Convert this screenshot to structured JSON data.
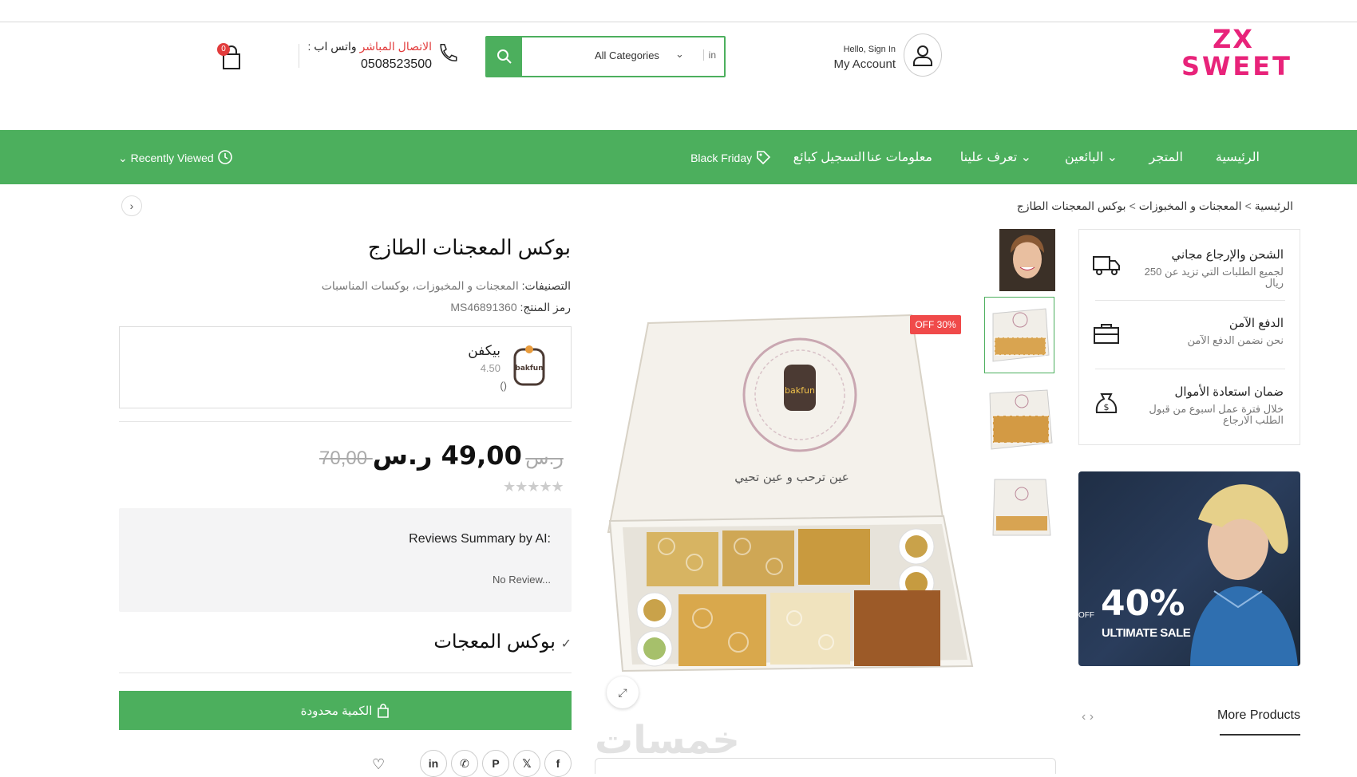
{
  "header": {
    "logo_line1": "ZX",
    "logo_line2": "SWEET",
    "account_greeting": "Hello, Sign In",
    "account_label": "My Account",
    "search_placeholder": "",
    "search_category": "All Categories",
    "search_in": "in",
    "contact_prefix": "الاتصال المباشر",
    "contact_suffix": "واتس اب :",
    "phone": "0508523500",
    "cart_count": "0"
  },
  "nav": {
    "items": [
      "الرئيسية",
      "المتجر",
      "البائعين",
      "تعرف علينا",
      "معلومات عنا",
      "التسجيل كبائع",
      "Black Friday"
    ],
    "recently_viewed": "Recently Viewed"
  },
  "breadcrumb": [
    "الرئيسية",
    "المعجنات و المخبوزات",
    "بوكس المعجنات الطازج"
  ],
  "features": [
    {
      "title": "الشحن والإرجاع مجاني",
      "subtitle": "لجميع الطلبات التي تزيد عن 250 ريال",
      "icon": "truck-icon"
    },
    {
      "title": "الدفع الآمن",
      "subtitle": "نحن نضمن الدفع الآمن",
      "icon": "briefcase-icon"
    },
    {
      "title": "ضمان استعادة الأموال",
      "subtitle": "خلال فترة عمل اسبوع من قبول الطلب الارجاع",
      "icon": "money-bag-icon"
    }
  ],
  "banner": {
    "percent": "40%",
    "off": "OFF",
    "sale": "ULTIMATE SALE"
  },
  "more_products": "More Products",
  "product": {
    "discount_badge": "OFF 30%",
    "title": "بوكس المعجنات الطازج",
    "categories_label": "التصنيفات:",
    "categories": "المعجنات و المخبوزات، بوكسات المناسبات",
    "sku_label": "رمز المنتج:",
    "sku": "MS46891360",
    "vendor_name": "بيكفن",
    "vendor_rating": "4.50",
    "vendor_reviews": "()",
    "vendor_logo_text": "bakfun",
    "price_new": "49,00 ر.س",
    "price_old": "70,00 ر.س",
    "rating_stars": 0,
    "ai_summary_title": "Reviews Summary by AI:",
    "ai_summary_body": "No Review...",
    "variant": "بوكس المعجات",
    "buy_button": "الكمية محدودة",
    "watermark": "خمسات"
  },
  "share_icons": [
    "facebook-icon",
    "x-icon",
    "pinterest-icon",
    "whatsapp-icon",
    "linkedin-icon"
  ],
  "colors": {
    "brand_green": "#4caf5d",
    "logo_pink": "#e8237a",
    "sale_red": "#f04a4a"
  }
}
